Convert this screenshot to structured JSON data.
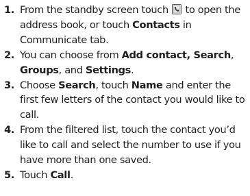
{
  "steps": [
    {
      "number": "1.",
      "parts": [
        {
          "text": "From the standby screen touch ",
          "bold": false
        },
        {
          "icon": "phonebook-icon"
        },
        {
          "text": " to open the address book, or touch ",
          "bold": false
        },
        {
          "text": "Contacts",
          "bold": true
        },
        {
          "text": " in Communicate tab.",
          "bold": false
        }
      ]
    },
    {
      "number": "2.",
      "parts": [
        {
          "text": "You can choose from ",
          "bold": false
        },
        {
          "text": "Add contact, Search",
          "bold": true
        },
        {
          "text": ", ",
          "bold": false
        },
        {
          "text": "Groups",
          "bold": true
        },
        {
          "text": ", and ",
          "bold": false
        },
        {
          "text": "Settings",
          "bold": true
        },
        {
          "text": ".",
          "bold": false
        }
      ]
    },
    {
      "number": "3.",
      "parts": [
        {
          "text": "Choose ",
          "bold": false
        },
        {
          "text": "Search",
          "bold": true
        },
        {
          "text": ", touch ",
          "bold": false
        },
        {
          "text": "Name",
          "bold": true
        },
        {
          "text": " and enter the first few letters of the contact you would like to call.",
          "bold": false
        }
      ]
    },
    {
      "number": "4.",
      "parts": [
        {
          "text": "From the filtered list, touch the contact you’d like to call and select the number to use if you have more than one saved.",
          "bold": false
        }
      ]
    },
    {
      "number": "5.",
      "parts": [
        {
          "text": "Touch ",
          "bold": false
        },
        {
          "text": "Call",
          "bold": true
        },
        {
          "text": ".",
          "bold": false
        }
      ]
    }
  ]
}
